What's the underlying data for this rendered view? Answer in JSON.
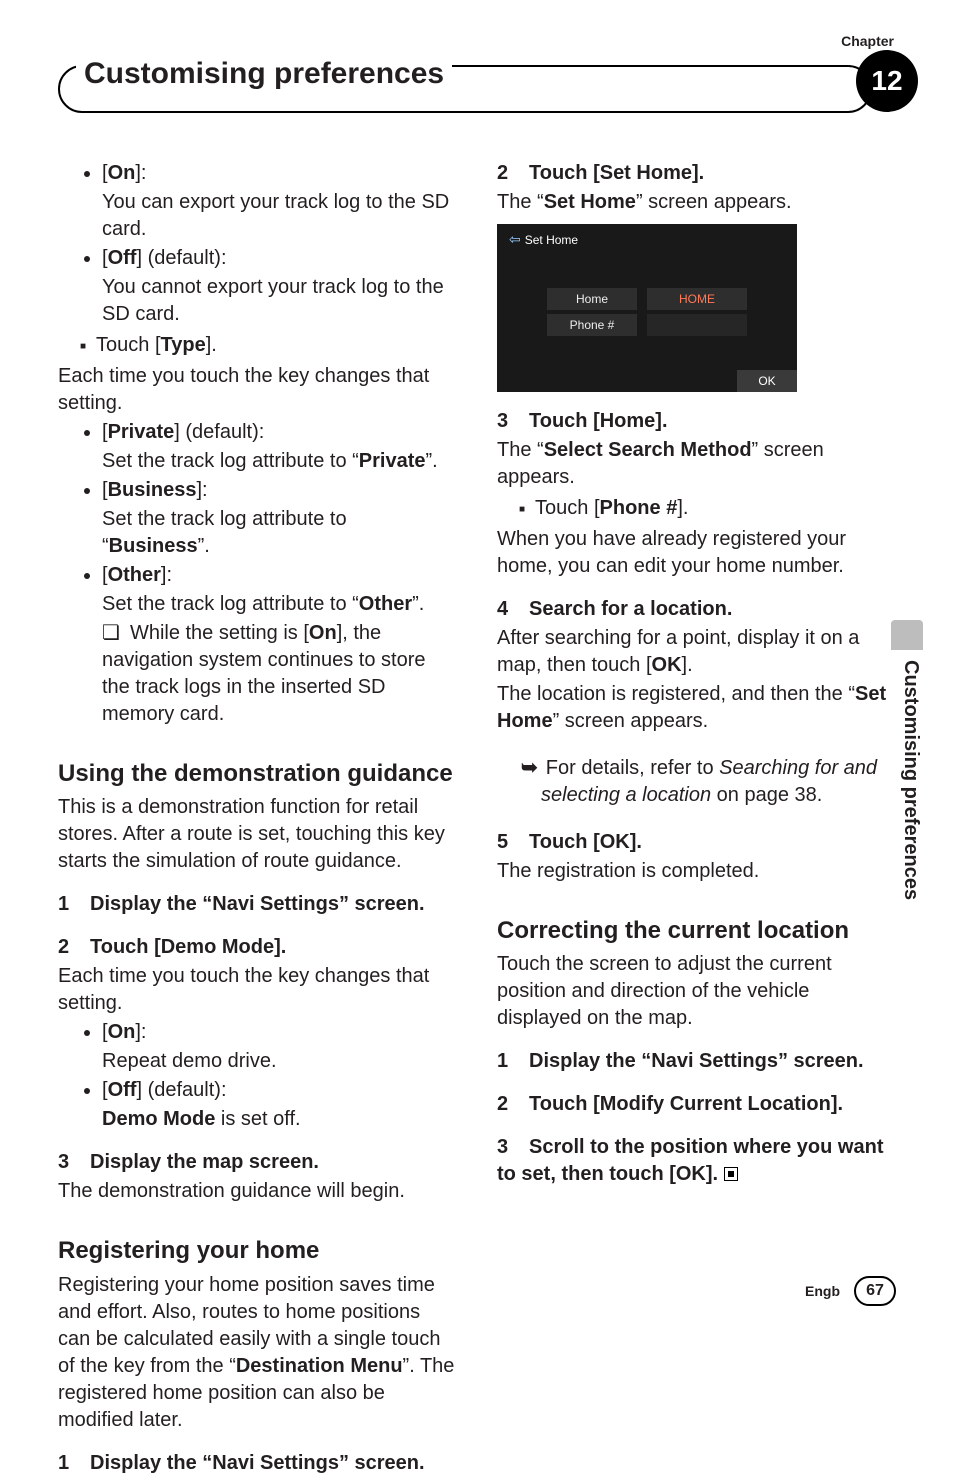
{
  "header": {
    "chapter_label": "Chapter",
    "chapter_number": "12",
    "title": "Customising preferences"
  },
  "side_tab": "Customising preferences",
  "footer": {
    "lang": "Engb",
    "page": "67"
  },
  "col1": {
    "on_label": "On",
    "on_desc": "You can export your track log to the SD card.",
    "off_label": "Off",
    "off_default": " (default):",
    "off_desc": "You cannot export your track log to the SD card.",
    "touch_type_prefix": "Touch [",
    "touch_type_bold": "Type",
    "touch_type_suffix": "].",
    "each_time": "Each time you touch the key changes that setting.",
    "private_label": "Private",
    "private_default": " (default):",
    "private_desc_pre": "Set the track log attribute to “",
    "private_desc_bold": "Private",
    "private_desc_post": "”.",
    "business_label": "Business",
    "business_desc_pre": "Set the track log attribute to “",
    "business_desc_bold": "Business",
    "business_desc_post": "”.",
    "other_label": "Other",
    "other_desc_pre": "Set the track log attribute to “",
    "other_desc_bold": "Other",
    "other_desc_post": "”.",
    "note_pre": "While the setting is [",
    "note_bold": "On",
    "note_post": "], the navigation system continues to store the track logs in the inserted SD memory card.",
    "demo_heading": "Using the demonstration guidance",
    "demo_intro": "This is a demonstration function for retail stores. After a route is set, touching this key starts the simulation of route guidance.",
    "step1": "Display the “Navi Settings” screen.",
    "step2": "Touch [Demo Mode].",
    "step2_after": "Each time you touch the key changes that setting.",
    "demo_on": "On",
    "demo_on_desc": "Repeat demo drive.",
    "demo_off": "Off",
    "demo_off_default": " (default):",
    "demo_off_desc_bold": "Demo Mode",
    "demo_off_desc_rest": " is set off.",
    "step3": "Display the map screen.",
    "step3_after": "The demonstration guidance will begin.",
    "reg_heading": "Registering your home",
    "reg_intro_pre": "Registering your home position saves time and effort. Also, routes to home positions can be calculated easily with a single touch of the key from the “",
    "reg_intro_bold": "Destination Menu",
    "reg_intro_post": "”. The registered home position can also be modified later.",
    "reg_step1": "Display the “Navi Settings” screen."
  },
  "col2": {
    "step2": "Touch [Set Home].",
    "step2_pre": "The “",
    "step2_bold": "Set Home",
    "step2_post": "” screen appears.",
    "shot": {
      "title": "Set Home",
      "home_label": "Home",
      "home_value": "HOME",
      "phone_label": "Phone #",
      "ok": "OK"
    },
    "step3": "Touch [Home].",
    "step3_pre": "The “",
    "step3_bold": "Select Search Method",
    "step3_post": "” screen appears.",
    "phone_touch_pre": "Touch [",
    "phone_touch_bold": "Phone #",
    "phone_touch_post": "].",
    "phone_desc": "When you have already registered your home, you can edit your home number.",
    "step4": "Search for a location.",
    "step4_line1_pre": "After searching for a point, display it on a map, then touch [",
    "step4_line1_bold": "OK",
    "step4_line1_post": "].",
    "step4_line2_pre": "The location is registered, and then the “",
    "step4_line2_bold": "Set Home",
    "step4_line2_post": "” screen appears.",
    "xref_pre": "For details, refer to ",
    "xref_ital": "Searching for and selecting a location",
    "xref_post": " on page 38.",
    "step5": "Touch [OK].",
    "step5_after": "The registration is completed.",
    "corr_heading": "Correcting the current location",
    "corr_intro": "Touch the screen to adjust the current position and direction of the vehicle displayed on the map.",
    "corr_step1": "Display the “Navi Settings” screen.",
    "corr_step2": "Touch [Modify Current Location].",
    "corr_step3": "Scroll to the position where you want to set, then touch [OK]."
  }
}
